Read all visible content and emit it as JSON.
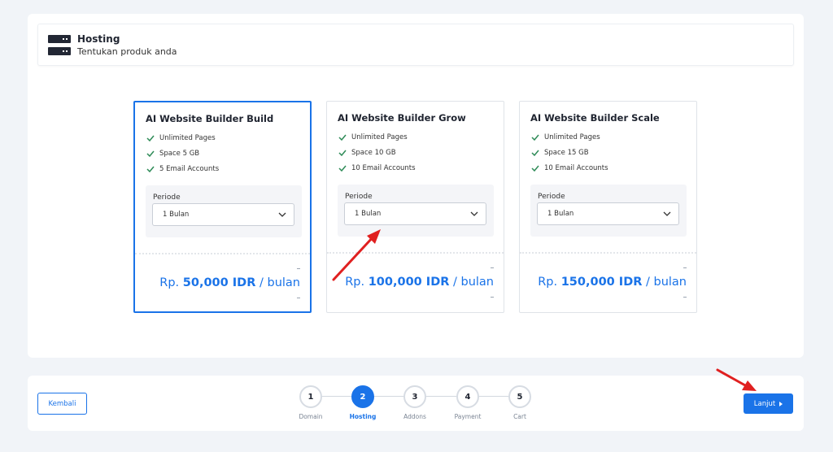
{
  "header": {
    "title": "Hosting",
    "subtitle": "Tentukan produk anda",
    "icon": "server-icon"
  },
  "plans": [
    {
      "name": "AI Website Builder Build",
      "features": [
        "Unlimited Pages",
        "Space 5 GB",
        "5 Email Accounts"
      ],
      "period_label": "Periode",
      "period_value": "1 Bulan",
      "price_prefix": "Rp.",
      "price_amount": "50,000 IDR",
      "price_suffix": "/ bulan",
      "selected": true
    },
    {
      "name": "AI Website Builder Grow",
      "features": [
        "Unlimited Pages",
        "Space 10 GB",
        "10 Email Accounts"
      ],
      "period_label": "Periode",
      "period_value": "1 Bulan",
      "price_prefix": "Rp.",
      "price_amount": "100,000 IDR",
      "price_suffix": "/ bulan",
      "selected": false
    },
    {
      "name": "AI Website Builder Scale",
      "features": [
        "Unlimited Pages",
        "Space 15 GB",
        "10 Email Accounts"
      ],
      "period_label": "Periode",
      "period_value": "1 Bulan",
      "price_prefix": "Rp.",
      "price_amount": "150,000 IDR",
      "price_suffix": "/ bulan",
      "selected": false
    }
  ],
  "nav": {
    "back_label": "Kembali",
    "next_label": "Lanjut"
  },
  "steps": [
    {
      "number": "1",
      "label": "Domain",
      "active": false
    },
    {
      "number": "2",
      "label": "Hosting",
      "active": true
    },
    {
      "number": "3",
      "label": "Addons",
      "active": false
    },
    {
      "number": "4",
      "label": "Payment",
      "active": false
    },
    {
      "number": "5",
      "label": "Cart",
      "active": false
    }
  ],
  "colors": {
    "accent": "#1a73e8",
    "check": "#2e8b57",
    "annotation_arrow": "#e02020",
    "background": "#f1f4f8"
  }
}
